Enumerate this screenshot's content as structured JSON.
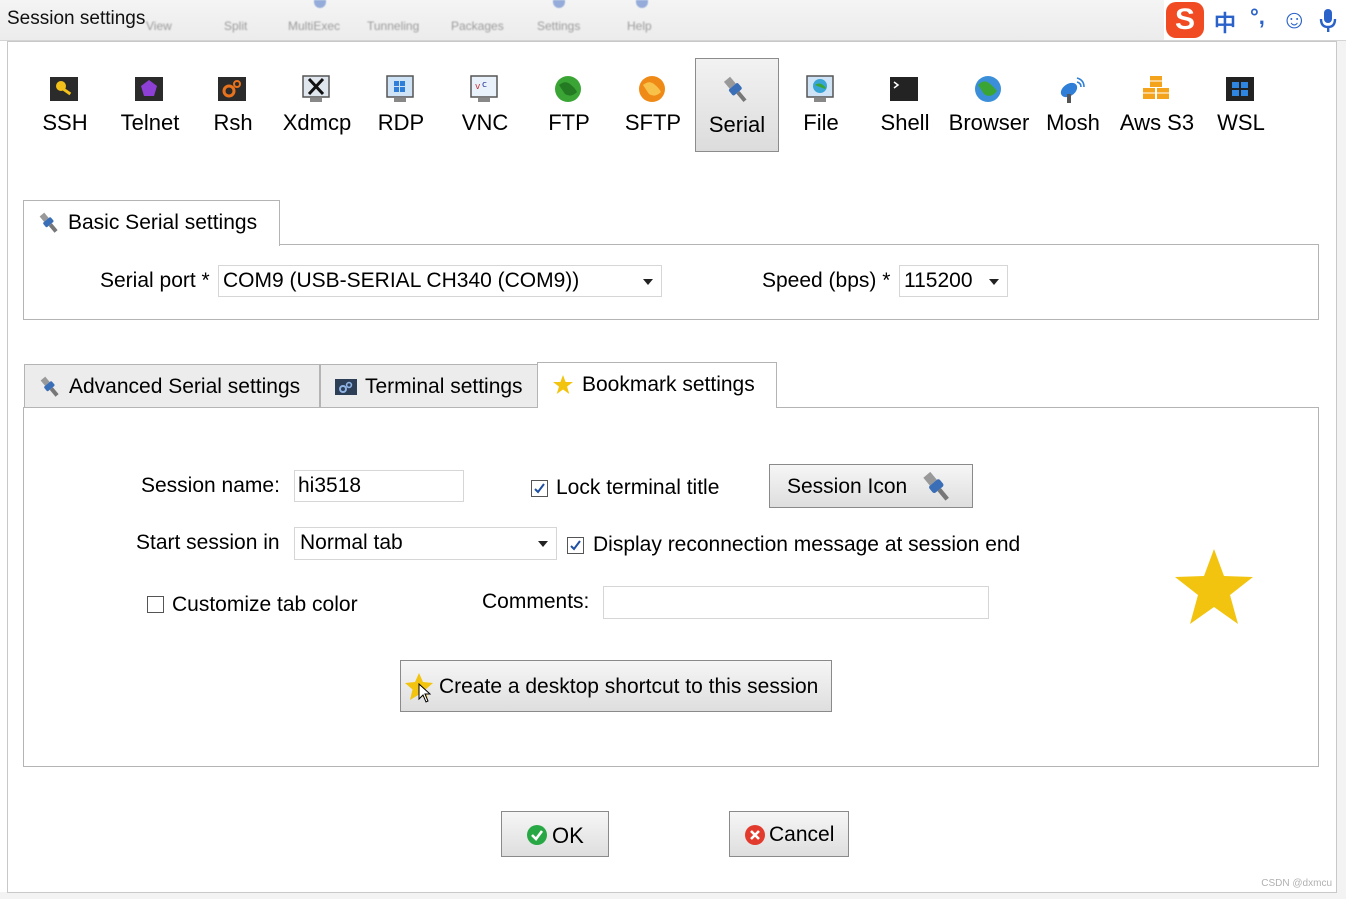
{
  "window": {
    "title": "Session settings",
    "ghost_menu": [
      "View",
      "Split",
      "MultiExec",
      "Tunneling",
      "Packages",
      "Settings",
      "Help"
    ]
  },
  "ime": {
    "logo": "S",
    "lang": "中",
    "punct": "°,",
    "emoji": "☺",
    "mic": "mic-icon"
  },
  "protocols": [
    {
      "label": "SSH",
      "icon": "key-icon"
    },
    {
      "label": "Telnet",
      "icon": "telnet-gem-icon"
    },
    {
      "label": "Rsh",
      "icon": "rsh-gear-icon"
    },
    {
      "label": "Xdmcp",
      "icon": "x-monitor-icon"
    },
    {
      "label": "RDP",
      "icon": "rdp-monitor-icon"
    },
    {
      "label": "VNC",
      "icon": "vnc-monitor-icon"
    },
    {
      "label": "FTP",
      "icon": "ftp-globe-icon"
    },
    {
      "label": "SFTP",
      "icon": "sftp-globe-icon"
    },
    {
      "label": "Serial",
      "icon": "serial-plug-icon",
      "active": true
    },
    {
      "label": "File",
      "icon": "file-monitor-icon"
    },
    {
      "label": "Shell",
      "icon": "shell-terminal-icon"
    },
    {
      "label": "Browser",
      "icon": "browser-globe-icon"
    },
    {
      "label": "Mosh",
      "icon": "satellite-dish-icon"
    },
    {
      "label": "Aws S3",
      "icon": "aws-cubes-icon"
    },
    {
      "label": "WSL",
      "icon": "windows-logo-icon"
    }
  ],
  "basic": {
    "tab_label": "Basic Serial settings",
    "serial_port_label": "Serial port *",
    "serial_port_value": "COM9  (USB-SERIAL CH340 (COM9))",
    "speed_label": "Speed (bps) *",
    "speed_value": "115200"
  },
  "tabs": [
    {
      "label": "Advanced Serial settings",
      "icon": "serial-plug-icon"
    },
    {
      "label": "Terminal settings",
      "icon": "terminal-gears-icon"
    },
    {
      "label": "Bookmark settings",
      "icon": "star-icon",
      "selected": true
    }
  ],
  "bookmark": {
    "session_name_label": "Session name:",
    "session_name_value": "hi3518",
    "lock_title_label": "Lock terminal title",
    "lock_title_checked": true,
    "session_icon_button": "Session Icon",
    "start_session_label": "Start session in",
    "start_session_value": "Normal tab",
    "reconnect_label": "Display reconnection message at session end",
    "reconnect_checked": true,
    "tab_color_label": "Customize tab color",
    "tab_color_checked": false,
    "comments_label": "Comments:",
    "comments_value": "",
    "shortcut_button": "Create a desktop shortcut to this session"
  },
  "footer": {
    "ok": "OK",
    "cancel": "Cancel"
  },
  "watermark": "CSDN @dxmcu",
  "colors": {
    "star": "#f2c40f",
    "ok": "#27a844",
    "cancel": "#e23b2e",
    "ime": "#2a62c9"
  }
}
